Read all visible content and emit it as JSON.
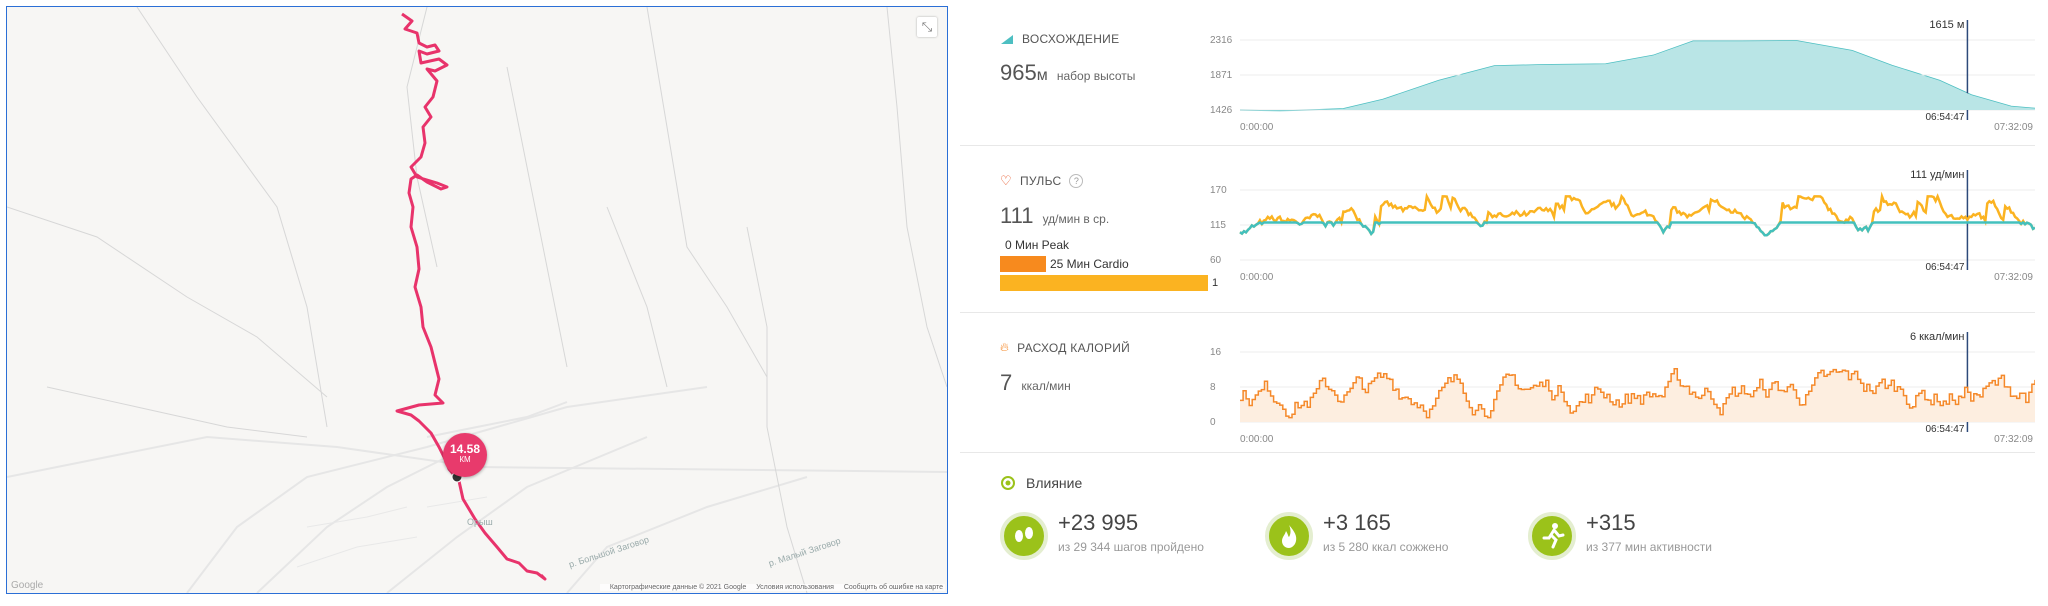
{
  "map": {
    "distance_value": "14.58",
    "distance_unit": "КМ",
    "logo_text": "Google",
    "attribution": [
      "Картографические данные © 2021 Google",
      "Условия использования",
      "Сообщить об ошибке на карте"
    ],
    "place_labels": [
      "Орыш",
      "р. Большой Заговор",
      "р. Малый Заговор"
    ],
    "route_color": "#e8336b",
    "fullscreen_icon": "fullscreen-exit-icon"
  },
  "elevation": {
    "title": "ВОСХОЖДЕНИЕ",
    "value": "965",
    "unit": "м",
    "desc": "набор высоты",
    "marker_label": "1615 м",
    "marker_time": "06:54:47",
    "time_start": "0:00:00",
    "time_end": "07:32:09",
    "color": "#4dbfc2",
    "chart_data": {
      "type": "area",
      "x_range": [
        "0:00:00",
        "07:32:09"
      ],
      "ylim": [
        1426,
        2316
      ],
      "yticks": [
        2316,
        1871,
        1426
      ],
      "x_fraction": [
        0,
        0.05,
        0.1,
        0.13,
        0.18,
        0.25,
        0.32,
        0.38,
        0.46,
        0.52,
        0.57,
        0.63,
        0.7,
        0.77,
        0.82,
        0.88,
        0.92,
        0.97,
        1
      ],
      "values": [
        1426,
        1420,
        1430,
        1440,
        1560,
        1800,
        1985,
        2000,
        2010,
        2120,
        2300,
        2300,
        2305,
        2180,
        1990,
        1800,
        1615,
        1470,
        1445
      ]
    }
  },
  "heart": {
    "title": "ПУЛЬС",
    "value": "111",
    "unit": "уд/мин в ср.",
    "marker_label": "111 уд/мин",
    "marker_time": "06:54:47",
    "time_start": "0:00:00",
    "time_end": "07:32:09",
    "zones": [
      {
        "label": "0 Мин Peak",
        "minutes": 0,
        "color": "#e64a19"
      },
      {
        "label": "25 Мин Cardio",
        "minutes": 25,
        "color": "#f78a1e"
      },
      {
        "label": "1",
        "minutes": 175,
        "color": "#fbb321"
      }
    ],
    "chart_data": {
      "type": "line",
      "ylim": [
        60,
        170
      ],
      "yticks": [
        170,
        115,
        60
      ],
      "threshold": 115,
      "series": [
        {
          "color_below": "#43c0bd",
          "color_above": "#fbb321"
        }
      ]
    }
  },
  "calories": {
    "title": "РАСХОД КАЛОРИЙ",
    "value": "7",
    "unit": "ккал/мин",
    "marker_label": "6 ккал/мин",
    "marker_time": "06:54:47",
    "time_start": "0:00:00",
    "time_end": "07:32:09",
    "color": "#f5892a",
    "chart_data": {
      "type": "area",
      "ylim": [
        0,
        16
      ],
      "yticks": [
        16,
        8,
        0
      ]
    }
  },
  "impact": {
    "title": "Влияние",
    "items": [
      {
        "value": "+23 995",
        "sub": "из 29 344 шагов пройдено",
        "icon": "footsteps-icon"
      },
      {
        "value": "+3 165",
        "sub": "из 5 280 ккал сожжено",
        "icon": "flame-icon"
      },
      {
        "value": "+315",
        "sub": "из 377 мин активности",
        "icon": "runner-icon"
      }
    ]
  }
}
